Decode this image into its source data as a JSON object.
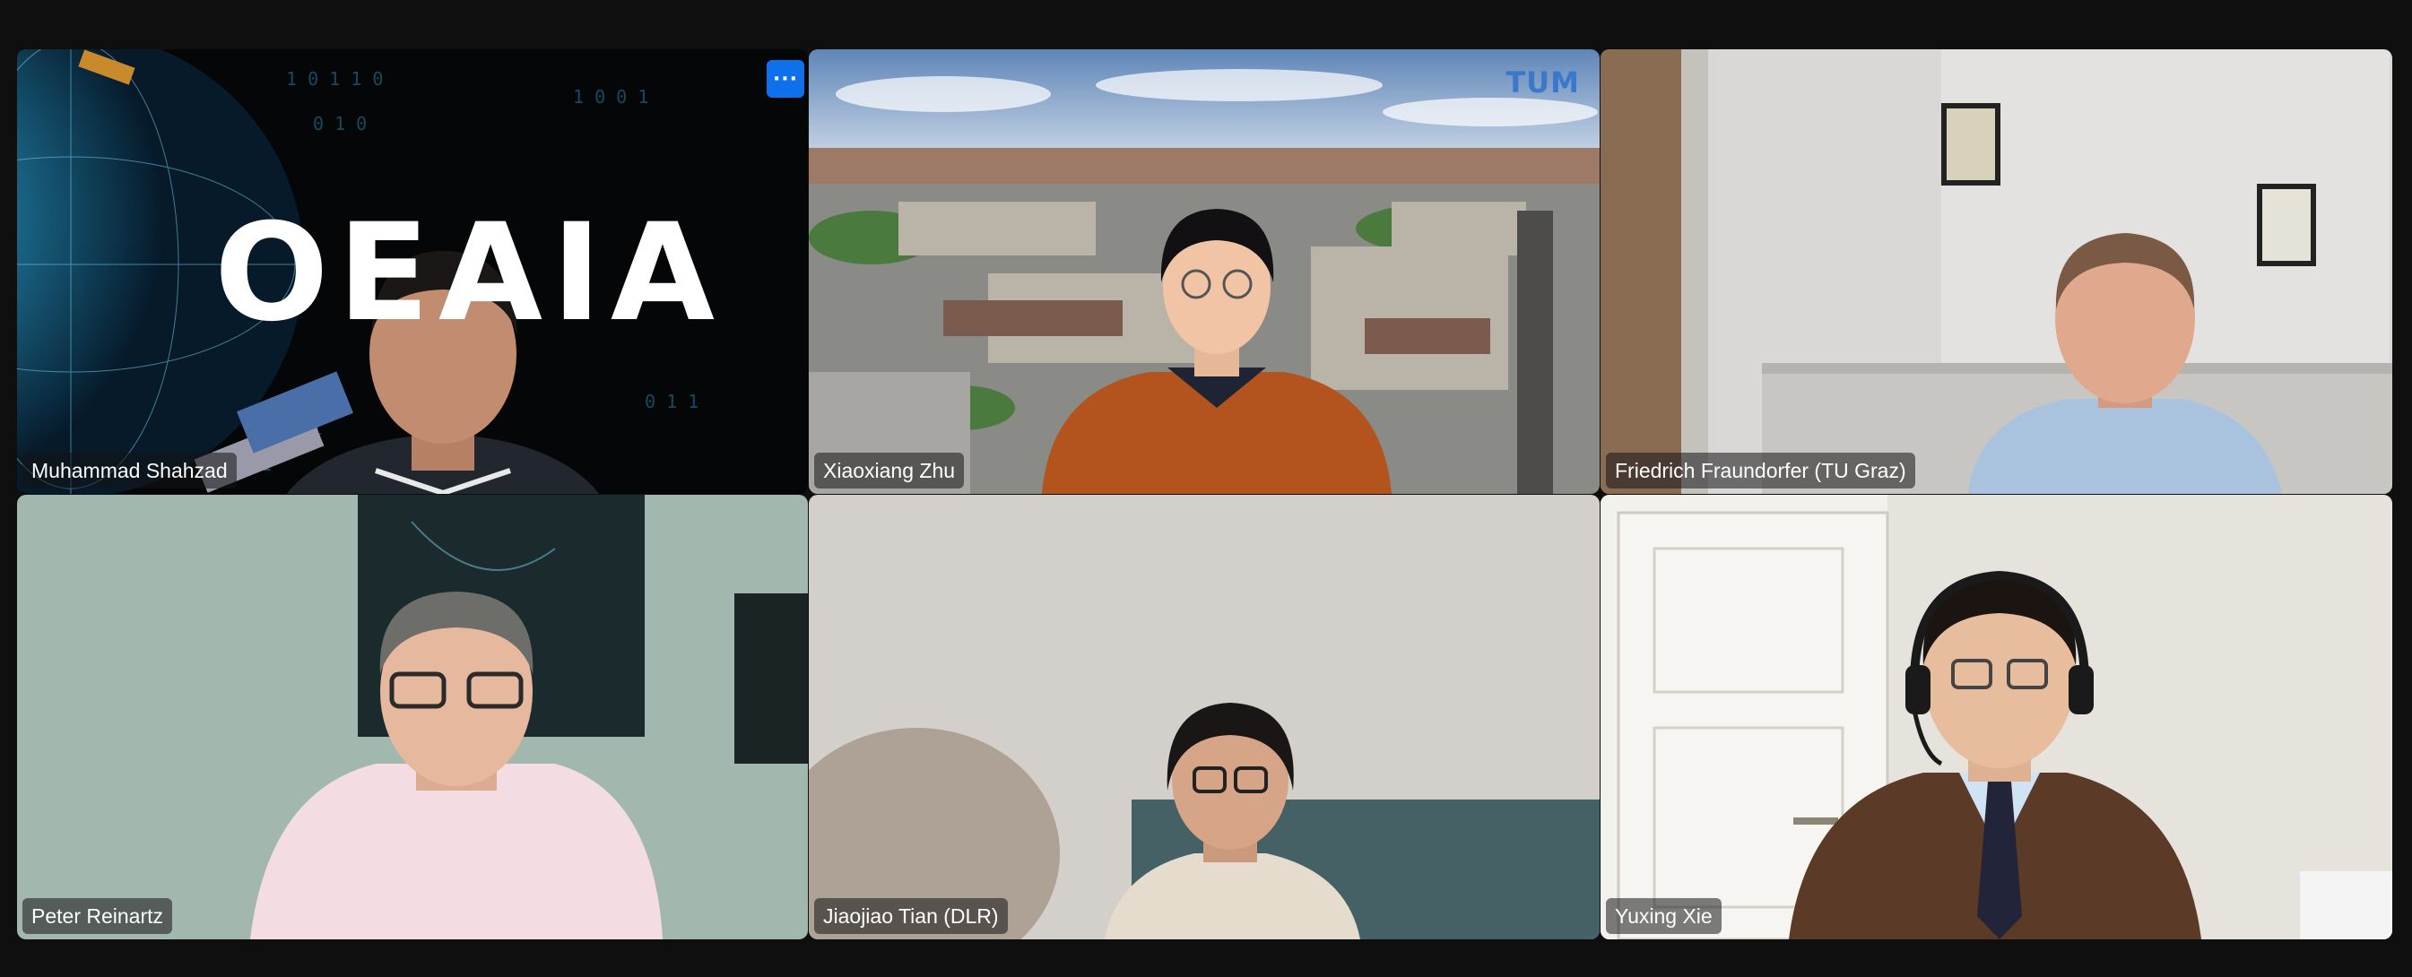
{
  "meeting": {
    "more_options_label": "···",
    "participants": [
      {
        "name": "Muhammad Shahzad",
        "background_text": "OEAIA",
        "speaking": false
      },
      {
        "name": "Xiaoxiang Zhu",
        "background_logo": "TUM",
        "speaking": false
      },
      {
        "name": "Friedrich Fraundorfer (TU Graz)",
        "speaking": false
      },
      {
        "name": "Peter Reinartz",
        "speaking": false
      },
      {
        "name": "Jiaojiao Tian (DLR)",
        "speaking": false
      },
      {
        "name": "Yuxing Xie",
        "speaking": true
      }
    ]
  },
  "colors": {
    "background": "#0f0f10",
    "active_speaker_border": "#2fd17d",
    "more_button": "#0e71eb"
  }
}
